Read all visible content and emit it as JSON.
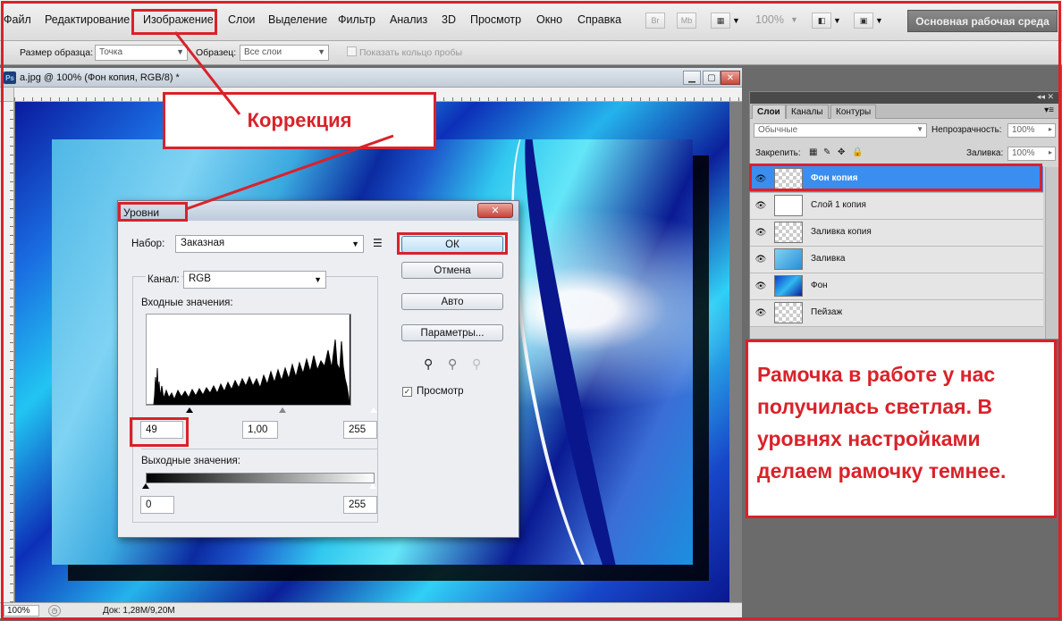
{
  "menu": {
    "items": [
      "Файл",
      "Редактирование",
      "Изображение",
      "Слои",
      "Выделение",
      "Фильтр",
      "Анализ",
      "3D",
      "Просмотр",
      "Окно",
      "Справка"
    ],
    "tool_br": "Br",
    "tool_mb": "Mb",
    "zoom_value": "100%",
    "workspace": "Основная рабочая среда"
  },
  "options": {
    "sample_size_label": "Размер образца:",
    "sample_size_value": "Точка",
    "sample_label": "Образец:",
    "sample_value": "Все слои",
    "show_ring_label": "Показать кольцо пробы"
  },
  "document": {
    "title": "a.jpg @ 100% (Фон копия, RGB/8) *",
    "ps_icon": "Ps",
    "status_zoom": "100%",
    "status_doc": "Док: 1,28M/9,20M"
  },
  "annotations": {
    "correction": "Коррекция",
    "note_lines": [
      "Рамочка в работе у нас",
      "получилась светлая. В",
      "уровнях настройками",
      "делаем рамочку темнее."
    ],
    "accent_color": "#d9222a"
  },
  "levels_dialog": {
    "title": "Уровни",
    "close": "✕",
    "preset_label": "Набор:",
    "preset_value": "Заказная",
    "channel_label": "Канал:",
    "channel_value": "RGB",
    "input_label": "Входные значения:",
    "input_black": "49",
    "input_gamma": "1,00",
    "input_white": "255",
    "output_label": "Выходные значения:",
    "output_black": "0",
    "output_white": "255",
    "buttons": {
      "ok": "ОК",
      "cancel": "Отмена",
      "auto": "Авто",
      "options": "Параметры..."
    },
    "preview_label": "Просмотр"
  },
  "layers_panel": {
    "tabs": [
      "Слои",
      "Каналы",
      "Контуры"
    ],
    "blend_mode": "Обычные",
    "opacity_label": "Непрозрачность:",
    "opacity_value": "100%",
    "lock_label": "Закрепить:",
    "fill_label": "Заливка:",
    "fill_value": "100%",
    "layers": [
      {
        "name": "Фон копия",
        "selected": true
      },
      {
        "name": "Слой 1 копия",
        "selected": false
      },
      {
        "name": "Заливка копия",
        "selected": false
      },
      {
        "name": "Заливка",
        "selected": false
      },
      {
        "name": "Фон",
        "selected": false
      },
      {
        "name": "Пейзаж",
        "selected": false
      }
    ]
  }
}
